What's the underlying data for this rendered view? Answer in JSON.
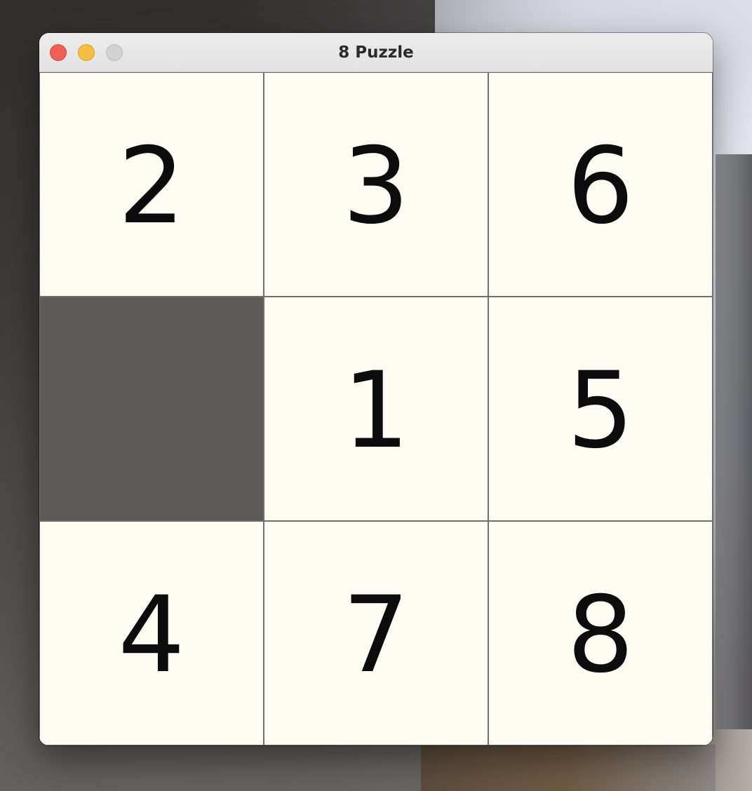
{
  "window": {
    "title": "8 Puzzle"
  },
  "colors": {
    "tile_background": "#fffcf3",
    "empty_tile": "#5c5b58",
    "grid_line": "#6f6d6a",
    "number": "#0c0c0c",
    "close_button": "#ee5f57",
    "minimize_button": "#f6bd40",
    "zoom_button_disabled": "#d3d3d3"
  },
  "board": {
    "rows": 3,
    "cols": 3,
    "tiles": [
      {
        "value": "2",
        "empty": false
      },
      {
        "value": "3",
        "empty": false
      },
      {
        "value": "6",
        "empty": false
      },
      {
        "value": "",
        "empty": true
      },
      {
        "value": "1",
        "empty": false
      },
      {
        "value": "5",
        "empty": false
      },
      {
        "value": "4",
        "empty": false
      },
      {
        "value": "7",
        "empty": false
      },
      {
        "value": "8",
        "empty": false
      }
    ]
  }
}
